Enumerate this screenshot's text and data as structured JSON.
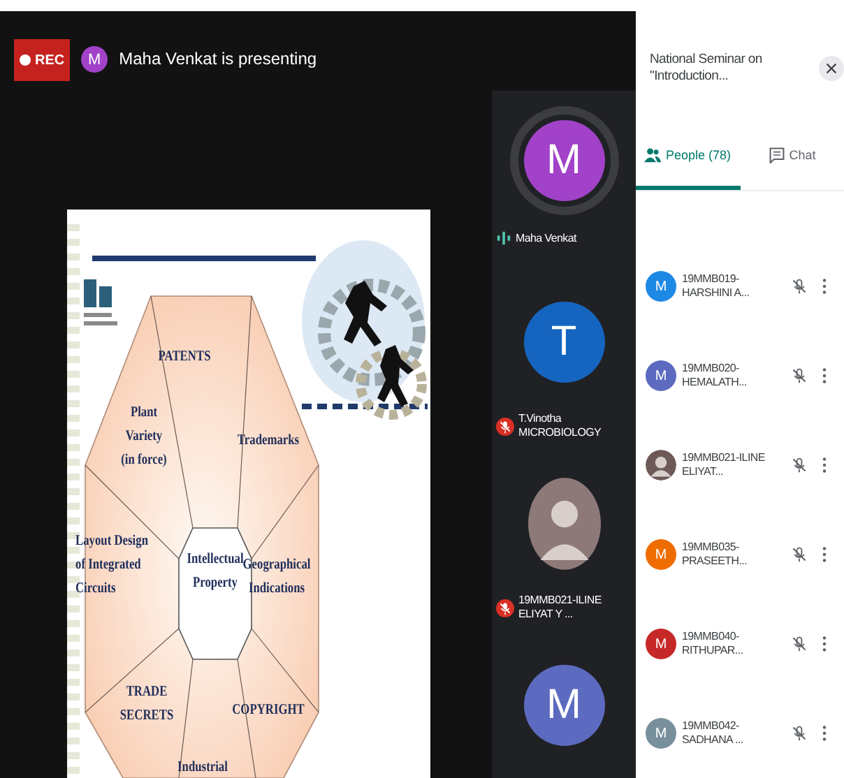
{
  "top_bar": {
    "rec_label": "REC",
    "presenter_initial": "M",
    "presenting_text": "Maha Venkat is presenting"
  },
  "slide": {
    "segments": [
      {
        "lines": [
          "PATENTS"
        ]
      },
      {
        "lines": [
          "Plant",
          "Variety",
          "(in force)"
        ]
      },
      {
        "lines": [
          "Trademarks"
        ]
      },
      {
        "lines": [
          "Layout Design",
          "of Integrated",
          "Circuits"
        ]
      },
      {
        "lines": [
          "Intellectual",
          "Property"
        ]
      },
      {
        "lines": [
          "Geographical",
          "Indications"
        ]
      },
      {
        "lines": [
          "TRADE",
          "SECRETS"
        ]
      },
      {
        "lines": [
          "COPYRIGHT"
        ]
      },
      {
        "lines": [
          "Industrial"
        ]
      }
    ]
  },
  "tiles": [
    {
      "kind": "letter",
      "initial": "M",
      "color": "#a142c9",
      "name": "Maha Venkat",
      "speaking": true,
      "muted": false
    },
    {
      "kind": "letter",
      "initial": "T",
      "color": "#1565c0",
      "name": "T.Vinotha MICROBIOLOGY",
      "speaking": false,
      "muted": true
    },
    {
      "kind": "photo",
      "name": "19MMB021-ILINE ELIYAT Y ...",
      "speaking": false,
      "muted": true
    },
    {
      "kind": "letter",
      "initial": "M",
      "color": "#5c6bc0",
      "speaking": false,
      "muted": false
    }
  ],
  "panel": {
    "title": "National Seminar on \"Introduction...",
    "tabs": [
      {
        "kind": "people",
        "label": "People (78)",
        "selected": true
      },
      {
        "kind": "chat",
        "label": "Chat",
        "selected": false
      }
    ],
    "participants": [
      {
        "kind": "letter",
        "initial": "M",
        "color": "#1e88e5",
        "name": "19MMB019-HARSHINI A...",
        "muted": true
      },
      {
        "kind": "letter",
        "initial": "M",
        "color": "#5c6bc0",
        "name": "19MMB020-HEMALATH...",
        "muted": true
      },
      {
        "kind": "photo",
        "name": "19MMB021-ILINE ELIYAT...",
        "muted": true
      },
      {
        "kind": "letter",
        "initial": "M",
        "color": "#ef6c00",
        "name": "19MMB035-PRASEETH...",
        "muted": true
      },
      {
        "kind": "letter",
        "initial": "M",
        "color": "#c62828",
        "name": "19MMB040-RITHUPAR...",
        "muted": true
      },
      {
        "kind": "letter",
        "initial": "M",
        "color": "#78909c",
        "name": "19MMB042-SADHANA ...",
        "muted": true
      }
    ]
  }
}
